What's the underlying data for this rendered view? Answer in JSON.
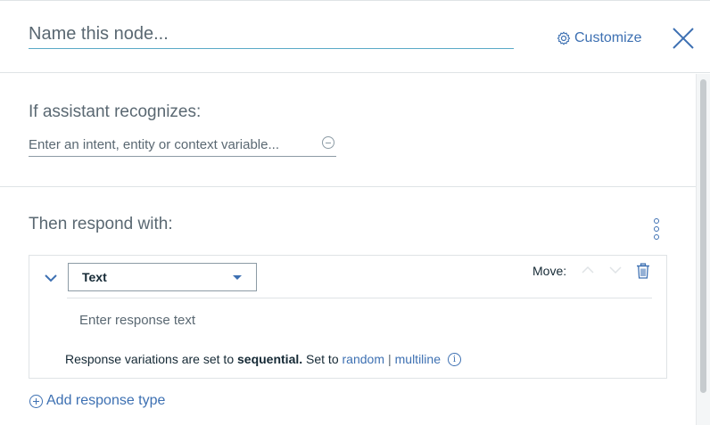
{
  "header": {
    "node_name_placeholder": "Name this node...",
    "customize_label": "Customize"
  },
  "conditions": {
    "title": "If assistant recognizes:",
    "placeholder": "Enter an intent, entity or context variable..."
  },
  "responses": {
    "title": "Then respond with:",
    "type_selected": "Text",
    "move_label": "Move:",
    "response_placeholder": "Enter response text",
    "variations_prefix": "Response variations are set to",
    "variations_mode": "sequential.",
    "variations_set_to": "Set to",
    "option_random": "random",
    "option_separator": "|",
    "option_multiline": "multiline",
    "add_response_label": "Add response type"
  },
  "colors": {
    "accent": "#3d70b2",
    "text": "#152935",
    "muted": "#5a6872",
    "border": "#dfe3e6"
  }
}
